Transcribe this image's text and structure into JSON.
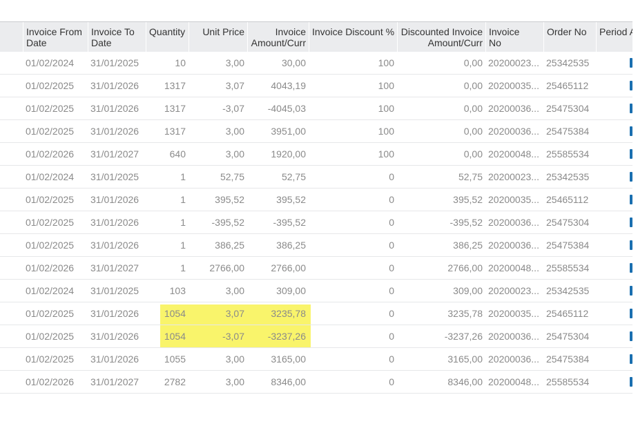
{
  "columns": [
    "",
    "Invoice From\nDate",
    "Invoice To\nDate",
    "Quantity",
    "Unit Price",
    "Invoice\nAmount/Curr",
    "Invoice Discount %",
    "Discounted Invoice\nAmount/Curr",
    "Invoice\nNo",
    "Order No",
    "Period A"
  ],
  "highlight_color": "#f9f46b",
  "rows": [
    [
      "01/02/2024",
      "31/01/2025",
      "10",
      "3,00",
      "30,00",
      "100",
      "0,00",
      "20200023...",
      "25342535"
    ],
    [
      "01/02/2025",
      "31/01/2026",
      "1317",
      "3,07",
      "4043,19",
      "100",
      "0,00",
      "20200035...",
      "25465112"
    ],
    [
      "01/02/2025",
      "31/01/2026",
      "1317",
      "-3,07",
      "-4045,03",
      "100",
      "0,00",
      "20200036...",
      "25475304"
    ],
    [
      "01/02/2025",
      "31/01/2026",
      "1317",
      "3,00",
      "3951,00",
      "100",
      "0,00",
      "20200036...",
      "25475384"
    ],
    [
      "01/02/2026",
      "31/01/2027",
      "640",
      "3,00",
      "1920,00",
      "100",
      "0,00",
      "20200048...",
      "25585534"
    ],
    [
      "01/02/2024",
      "31/01/2025",
      "1",
      "52,75",
      "52,75",
      "0",
      "52,75",
      "20200023...",
      "25342535"
    ],
    [
      "01/02/2025",
      "31/01/2026",
      "1",
      "395,52",
      "395,52",
      "0",
      "395,52",
      "20200035...",
      "25465112"
    ],
    [
      "01/02/2025",
      "31/01/2026",
      "1",
      "-395,52",
      "-395,52",
      "0",
      "-395,52",
      "20200036...",
      "25475304"
    ],
    [
      "01/02/2025",
      "31/01/2026",
      "1",
      "386,25",
      "386,25",
      "0",
      "386,25",
      "20200036...",
      "25475384"
    ],
    [
      "01/02/2026",
      "31/01/2027",
      "1",
      "2766,00",
      "2766,00",
      "0",
      "2766,00",
      "20200048...",
      "25585534"
    ],
    [
      "01/02/2024",
      "31/01/2025",
      "103",
      "3,00",
      "309,00",
      "0",
      "309,00",
      "20200023...",
      "25342535"
    ],
    [
      "01/02/2025",
      "31/01/2026",
      "1054",
      "3,07",
      "3235,78",
      "0",
      "3235,78",
      "20200035...",
      "25465112"
    ],
    [
      "01/02/2025",
      "31/01/2026",
      "1054",
      "-3,07",
      "-3237,26",
      "0",
      "-3237,26",
      "20200036...",
      "25475304"
    ],
    [
      "01/02/2025",
      "31/01/2026",
      "1055",
      "3,00",
      "3165,00",
      "0",
      "3165,00",
      "20200036...",
      "25475384"
    ],
    [
      "01/02/2026",
      "31/01/2027",
      "2782",
      "3,00",
      "8346,00",
      "0",
      "8346,00",
      "20200048...",
      "25585534"
    ]
  ]
}
